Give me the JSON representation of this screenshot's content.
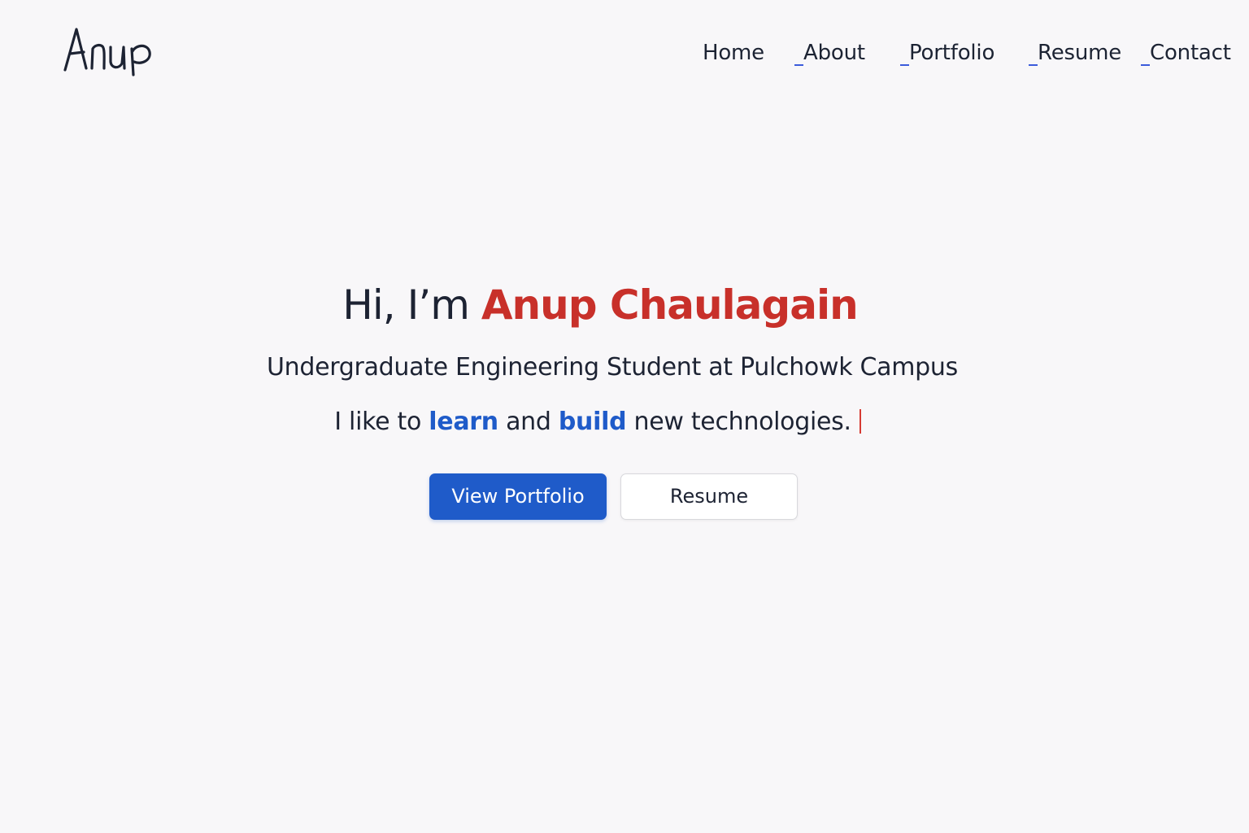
{
  "brand": {
    "logo_text": "Anup"
  },
  "nav": {
    "items": [
      {
        "label": "Home",
        "prefix": ""
      },
      {
        "label": "About",
        "prefix": "_"
      },
      {
        "label": "Portfolio",
        "prefix": "_"
      },
      {
        "label": "Resume",
        "prefix": "_"
      },
      {
        "label": "Contact",
        "prefix": "_"
      }
    ]
  },
  "hero": {
    "greeting": "Hi, I’m",
    "name": "Anup Chaulagain",
    "subtitle": "Undergraduate Engineering Student at Pulchowk Campus",
    "tagline_part1": "I like to",
    "tagline_word1": "learn",
    "tagline_part2": "and",
    "tagline_word2": "build",
    "tagline_part3": "new technologies."
  },
  "buttons": {
    "primary_label": "View Portfolio",
    "secondary_label": "Resume"
  },
  "colors": {
    "background": "#f8f7f9",
    "text": "#1d2333",
    "name_accent": "#c8302a",
    "link_accent": "#1f5bc9",
    "primary_button": "#1f5bc9",
    "caret": "#d63a33"
  }
}
